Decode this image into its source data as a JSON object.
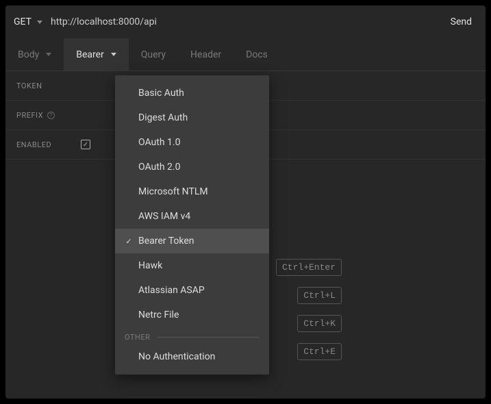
{
  "method": "GET",
  "url": "http://localhost:8000/api",
  "send_label": "Send",
  "tabs": {
    "body": "Body",
    "auth": "Bearer",
    "query": "Query",
    "header": "Header",
    "docs": "Docs"
  },
  "form": {
    "token_label": "TOKEN",
    "prefix_label": "PREFIX",
    "enabled_label": "ENABLED"
  },
  "auth_menu": {
    "items": [
      "Basic Auth",
      "Digest Auth",
      "OAuth 1.0",
      "OAuth 2.0",
      "Microsoft NTLM",
      "AWS IAM v4",
      "Bearer Token",
      "Hawk",
      "Atlassian ASAP",
      "Netrc File"
    ],
    "other_label": "OTHER",
    "other_items": [
      "No Authentication"
    ],
    "selected": "Bearer Token"
  },
  "shortcuts": [
    "Ctrl+Enter",
    "Ctrl+L",
    "Ctrl+K",
    "Ctrl+E"
  ]
}
